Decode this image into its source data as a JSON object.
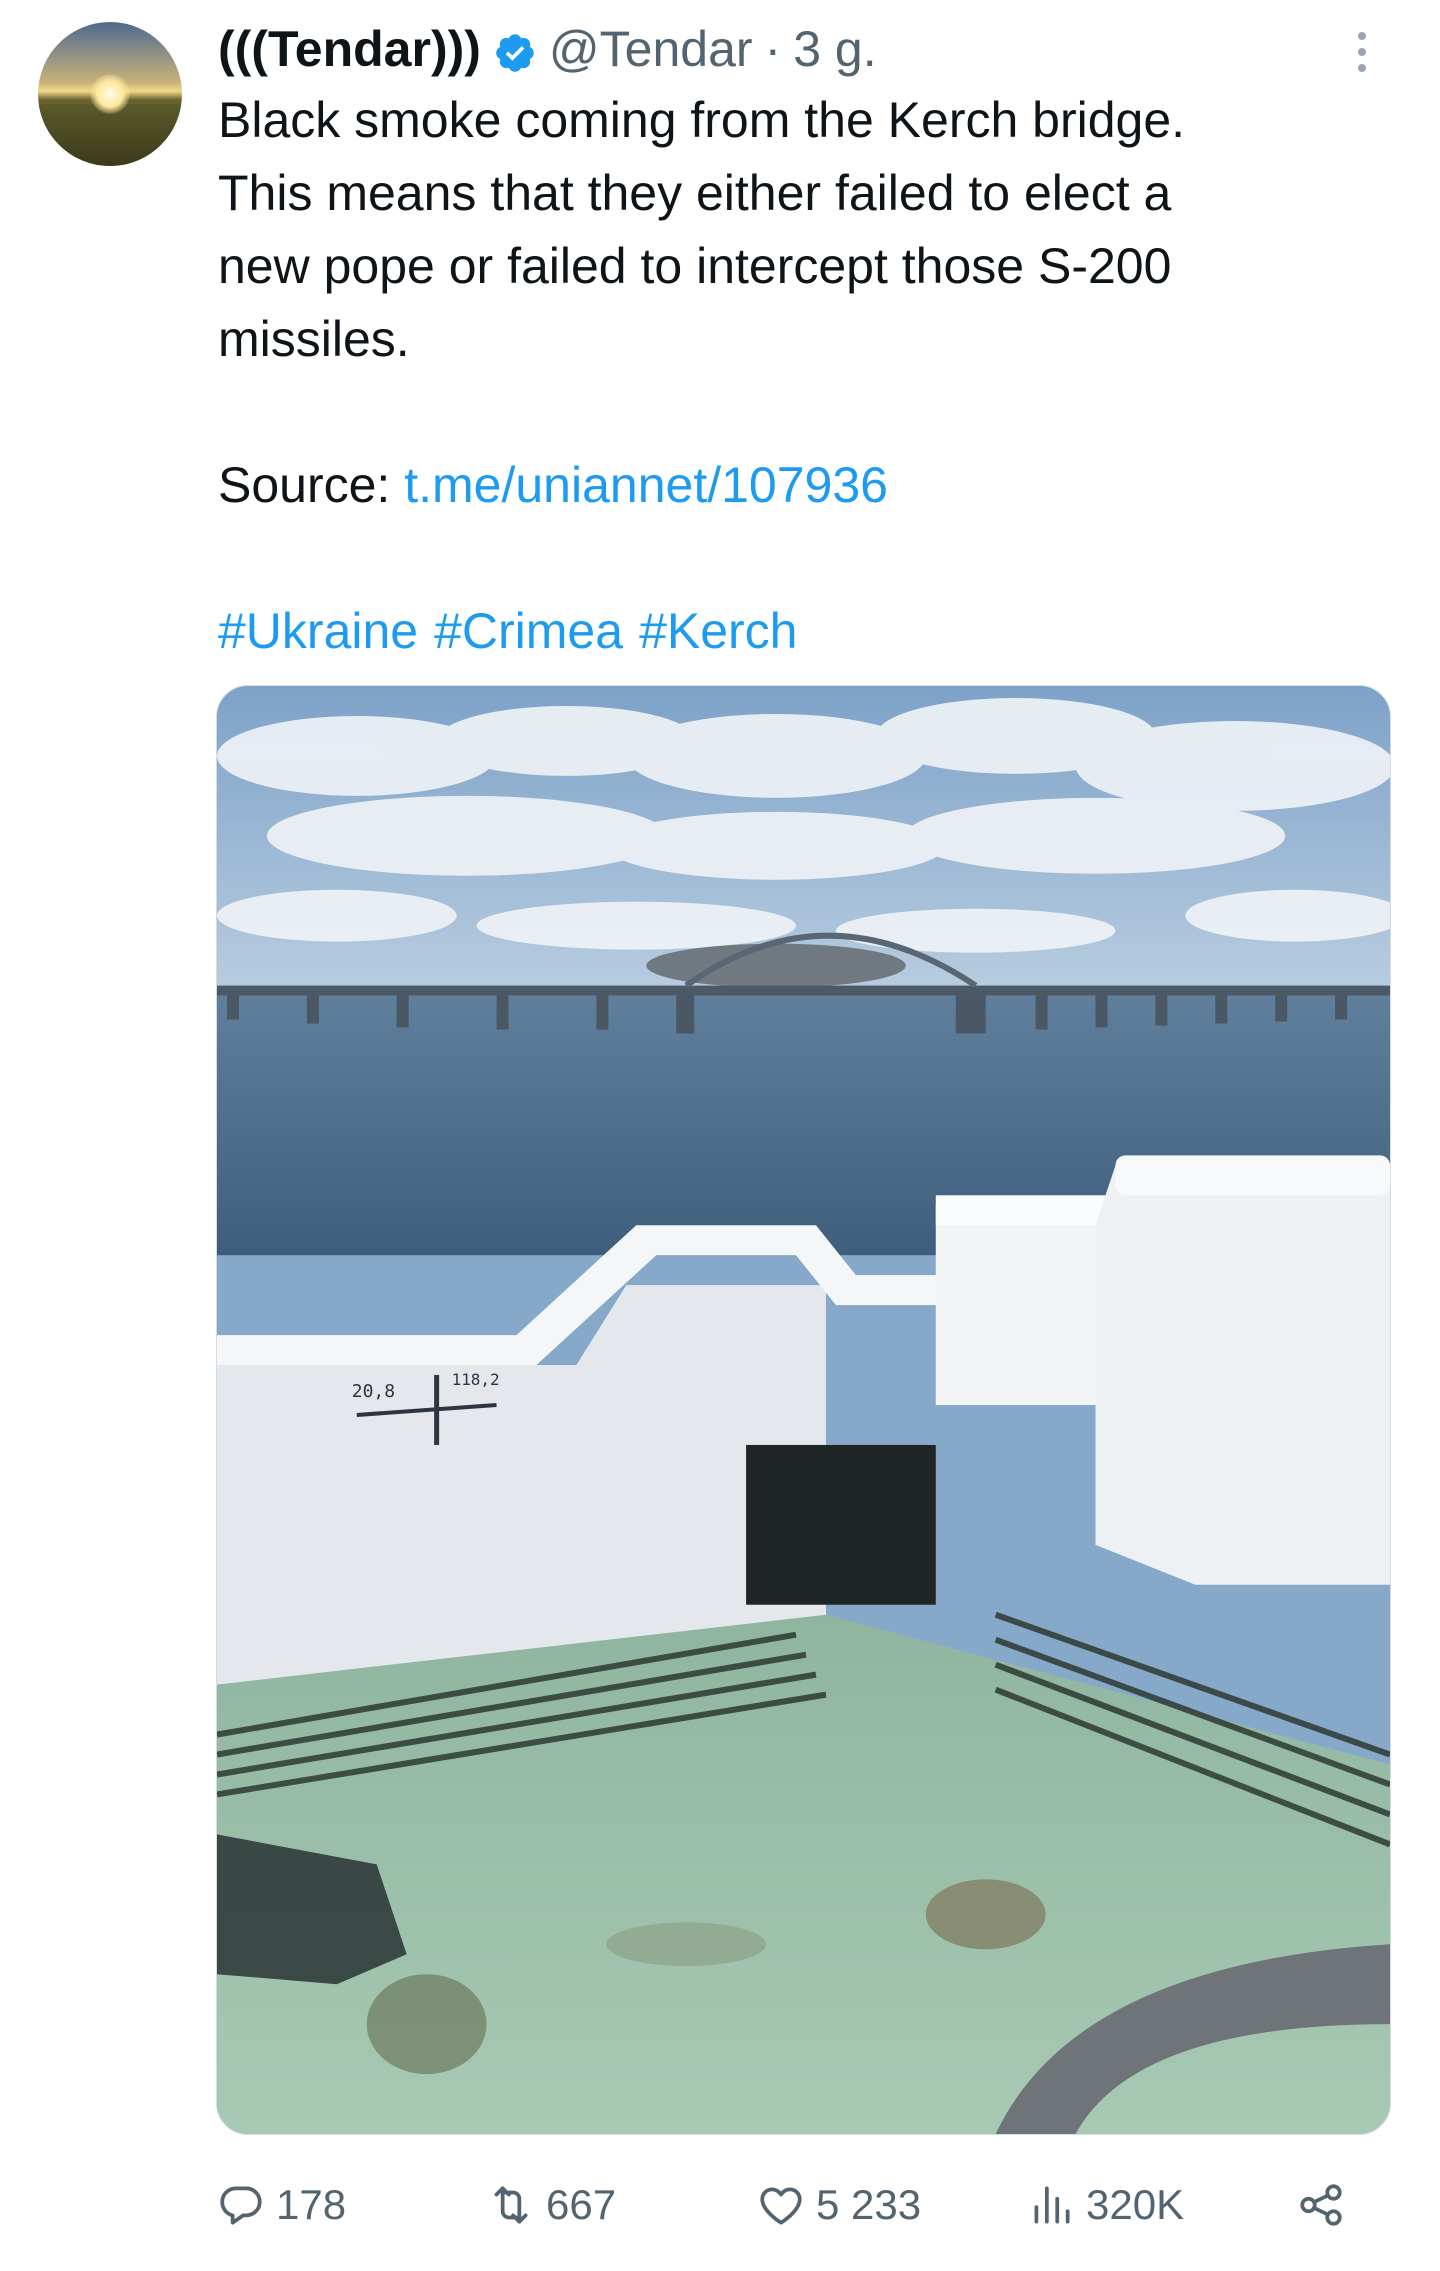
{
  "author": {
    "display_name": "(((Tendar)))",
    "handle": "@Tendar",
    "separator": "·",
    "time": "3 g."
  },
  "tweet": {
    "lines": [
      "Black smoke coming from the Kerch bridge.",
      "This means that they either failed to elect a",
      "new pope or failed to intercept those S-200",
      "missiles."
    ],
    "source_label": "Source:",
    "source_link": "t.me/uniannet/107936",
    "hashtags": [
      "#Ukraine",
      "#Crimea",
      "#Kerch"
    ]
  },
  "media": {
    "marking_left": "20,8",
    "marking_right": "118,2"
  },
  "actions": {
    "replies": "178",
    "retweets": "667",
    "likes": "5 233",
    "views": "320K"
  },
  "icons": {
    "verified": "verified-badge-icon",
    "more": "more-dots-icon",
    "reply": "reply-icon",
    "retweet": "retweet-icon",
    "like": "heart-icon",
    "views": "views-chart-icon",
    "share": "share-icon"
  },
  "colors": {
    "link": "#1d9bf0",
    "secondary_text": "#536471",
    "primary_text": "#0f1419"
  }
}
